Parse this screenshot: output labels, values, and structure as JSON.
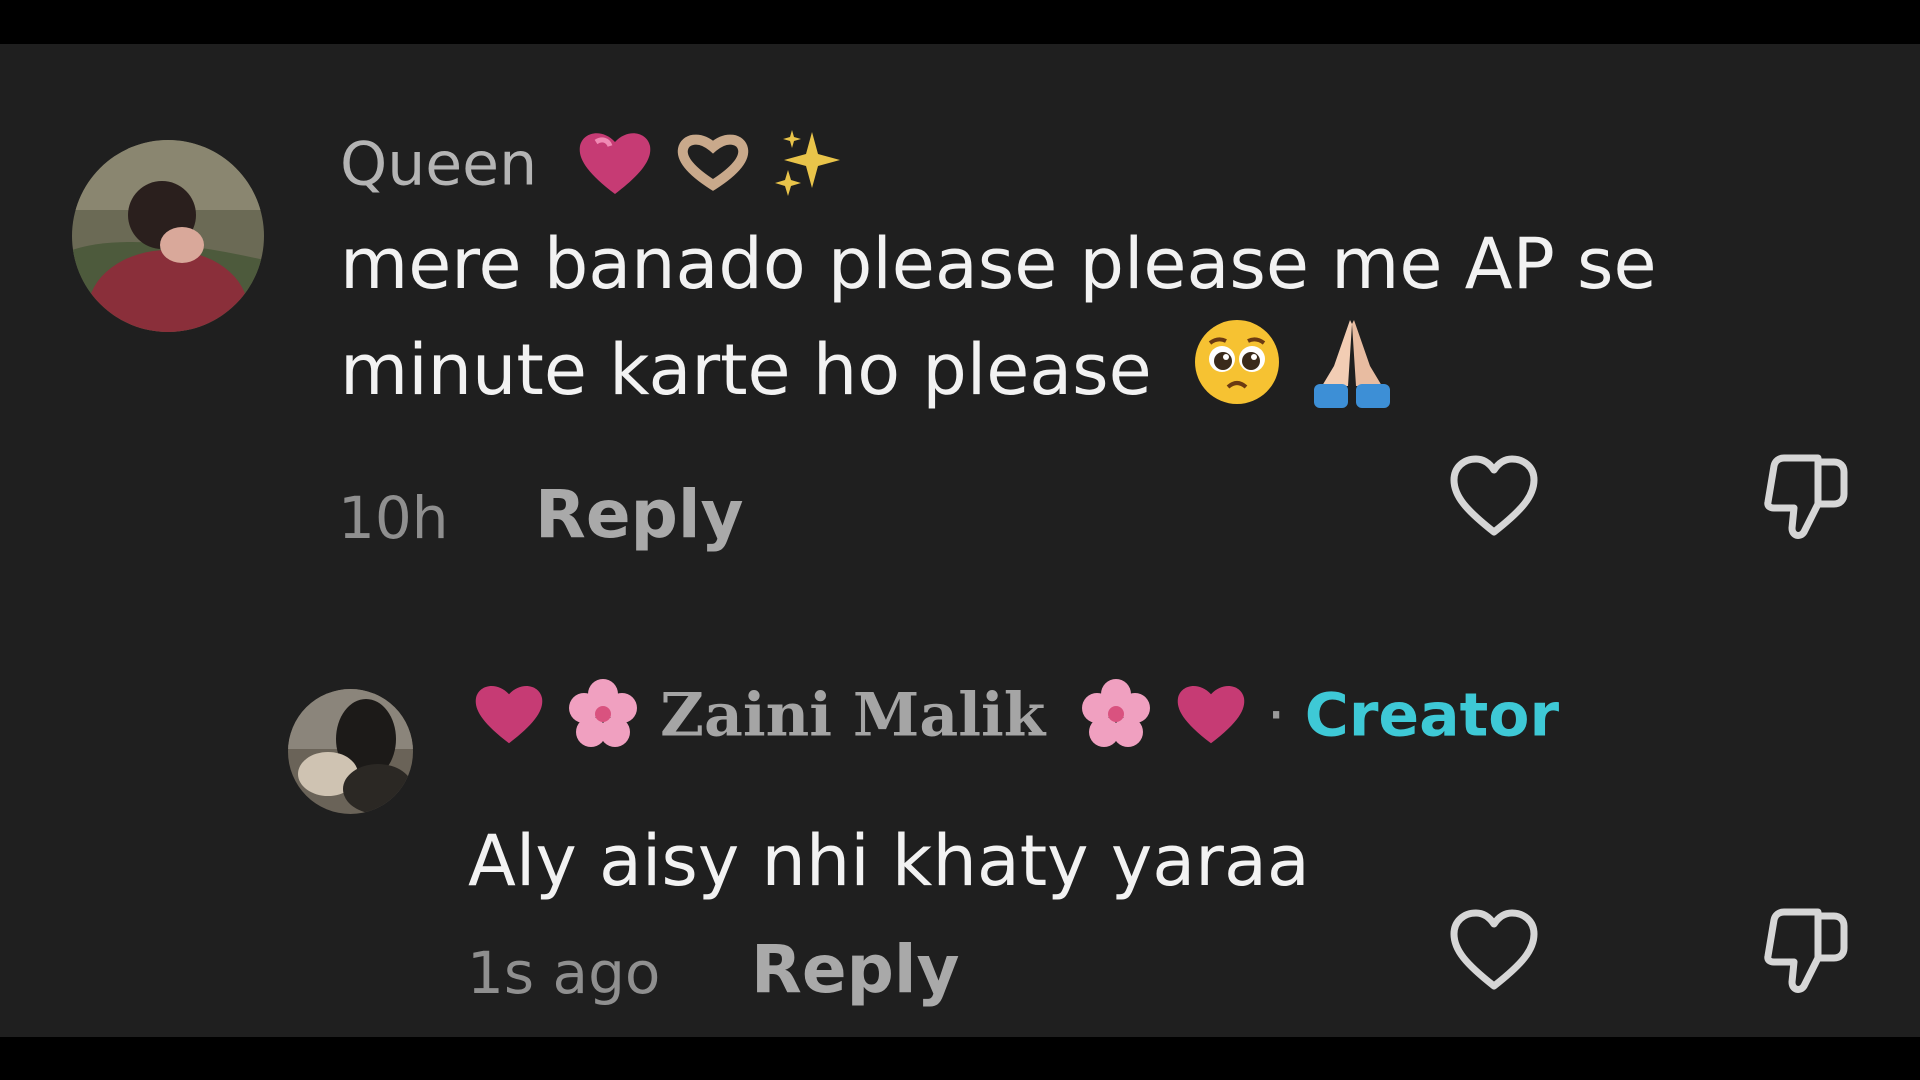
{
  "comments": [
    {
      "username": "Queen",
      "text_line1": "mere banado please please me AP se",
      "text_line2": "minute karte ho please",
      "time": "10h",
      "reply_label": "Reply"
    }
  ],
  "reply": {
    "username": "Zaini Malik",
    "separator": "·",
    "badge": "Creator",
    "text": "Aly aisy nhi khaty yaraa",
    "time": "1s ago",
    "reply_label": "Reply"
  },
  "icons": {
    "like": "heart-outline-icon",
    "dislike": "thumbs-down-outline-icon"
  },
  "colors": {
    "background": "#1f1f1f",
    "creator_badge": "#3ec9d6",
    "username": "#b4b4b4",
    "text": "#f2f2f2"
  }
}
